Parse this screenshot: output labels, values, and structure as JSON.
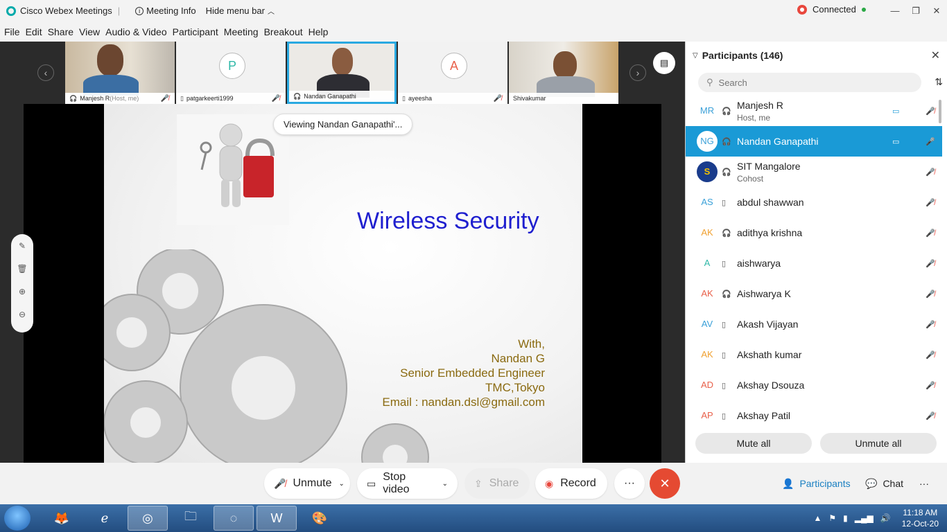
{
  "titlebar": {
    "app_name": "Cisco Webex Meetings",
    "meeting_info": "Meeting Info",
    "hide_menu": "Hide menu bar",
    "status": "Connected"
  },
  "menubar": [
    "File",
    "Edit",
    "Share",
    "View",
    "Audio & Video",
    "Participant",
    "Meeting",
    "Breakout",
    "Help"
  ],
  "thumbnails": [
    {
      "name": "Manjesh R",
      "suffix": " (Host, me)",
      "type": "video",
      "muted": true
    },
    {
      "name": "patgarkeerti1999",
      "letter": "P",
      "type": "avatar",
      "muted": true
    },
    {
      "name": "Nandan Ganapathi",
      "type": "video",
      "selected": true,
      "muted": false
    },
    {
      "name": "ayeesha",
      "letter": "A",
      "type": "avatar",
      "muted": true
    },
    {
      "name": "Shivakumar",
      "type": "video",
      "muted": false
    }
  ],
  "viewing_label": "Viewing Nandan Ganapathi'...",
  "slide": {
    "title": "Wireless Security",
    "credits": [
      "With,",
      "Nandan G",
      "Senior Embedded Engineer",
      "TMC,Tokyo",
      "Email : nandan.dsl@gmail.com"
    ]
  },
  "participants": {
    "header": "Participants (146)",
    "search_placeholder": "Search",
    "list": [
      {
        "initials": "MR",
        "name": "Manjesh R",
        "role": "Host, me",
        "device": "headset",
        "video": true,
        "color": "#3aa0d8"
      },
      {
        "initials": "NG",
        "name": "Nandan Ganapathi",
        "role": "",
        "device": "headset",
        "video": true,
        "selected": true,
        "color": "#3aa0d8"
      },
      {
        "initials": "",
        "name": "SIT Mangalore",
        "role": "Cohost",
        "device": "headset",
        "video": false,
        "logo": true,
        "color": "#1a3c8c"
      },
      {
        "initials": "AS",
        "name": "abdul shawwan",
        "role": "",
        "device": "phone",
        "video": false,
        "color": "#3aa0d8"
      },
      {
        "initials": "AK",
        "name": "adithya krishna",
        "role": "",
        "device": "headset",
        "video": false,
        "color": "#f0a030"
      },
      {
        "initials": "A",
        "name": "aishwarya",
        "role": "",
        "device": "phone",
        "video": false,
        "color": "#30b8a8"
      },
      {
        "initials": "AK",
        "name": "Aishwarya K",
        "role": "",
        "device": "headset",
        "video": false,
        "color": "#e8604a"
      },
      {
        "initials": "AV",
        "name": "Akash Vijayan",
        "role": "",
        "device": "phone",
        "video": false,
        "color": "#3aa0d8"
      },
      {
        "initials": "AK",
        "name": "Akshath kumar",
        "role": "",
        "device": "phone",
        "video": false,
        "color": "#f0a030"
      },
      {
        "initials": "AD",
        "name": "Akshay Dsouza",
        "role": "",
        "device": "phone",
        "video": false,
        "color": "#e8604a"
      },
      {
        "initials": "AP",
        "name": "Akshay Patil",
        "role": "",
        "device": "phone",
        "video": false,
        "color": "#e8604a"
      }
    ],
    "mute_all": "Mute all",
    "unmute_all": "Unmute all"
  },
  "controls": {
    "unmute": "Unmute",
    "stop_video": "Stop video",
    "share": "Share",
    "record": "Record",
    "participants": "Participants",
    "chat": "Chat"
  },
  "taskbar": {
    "time": "11:18 AM",
    "date": "12-Oct-20"
  }
}
